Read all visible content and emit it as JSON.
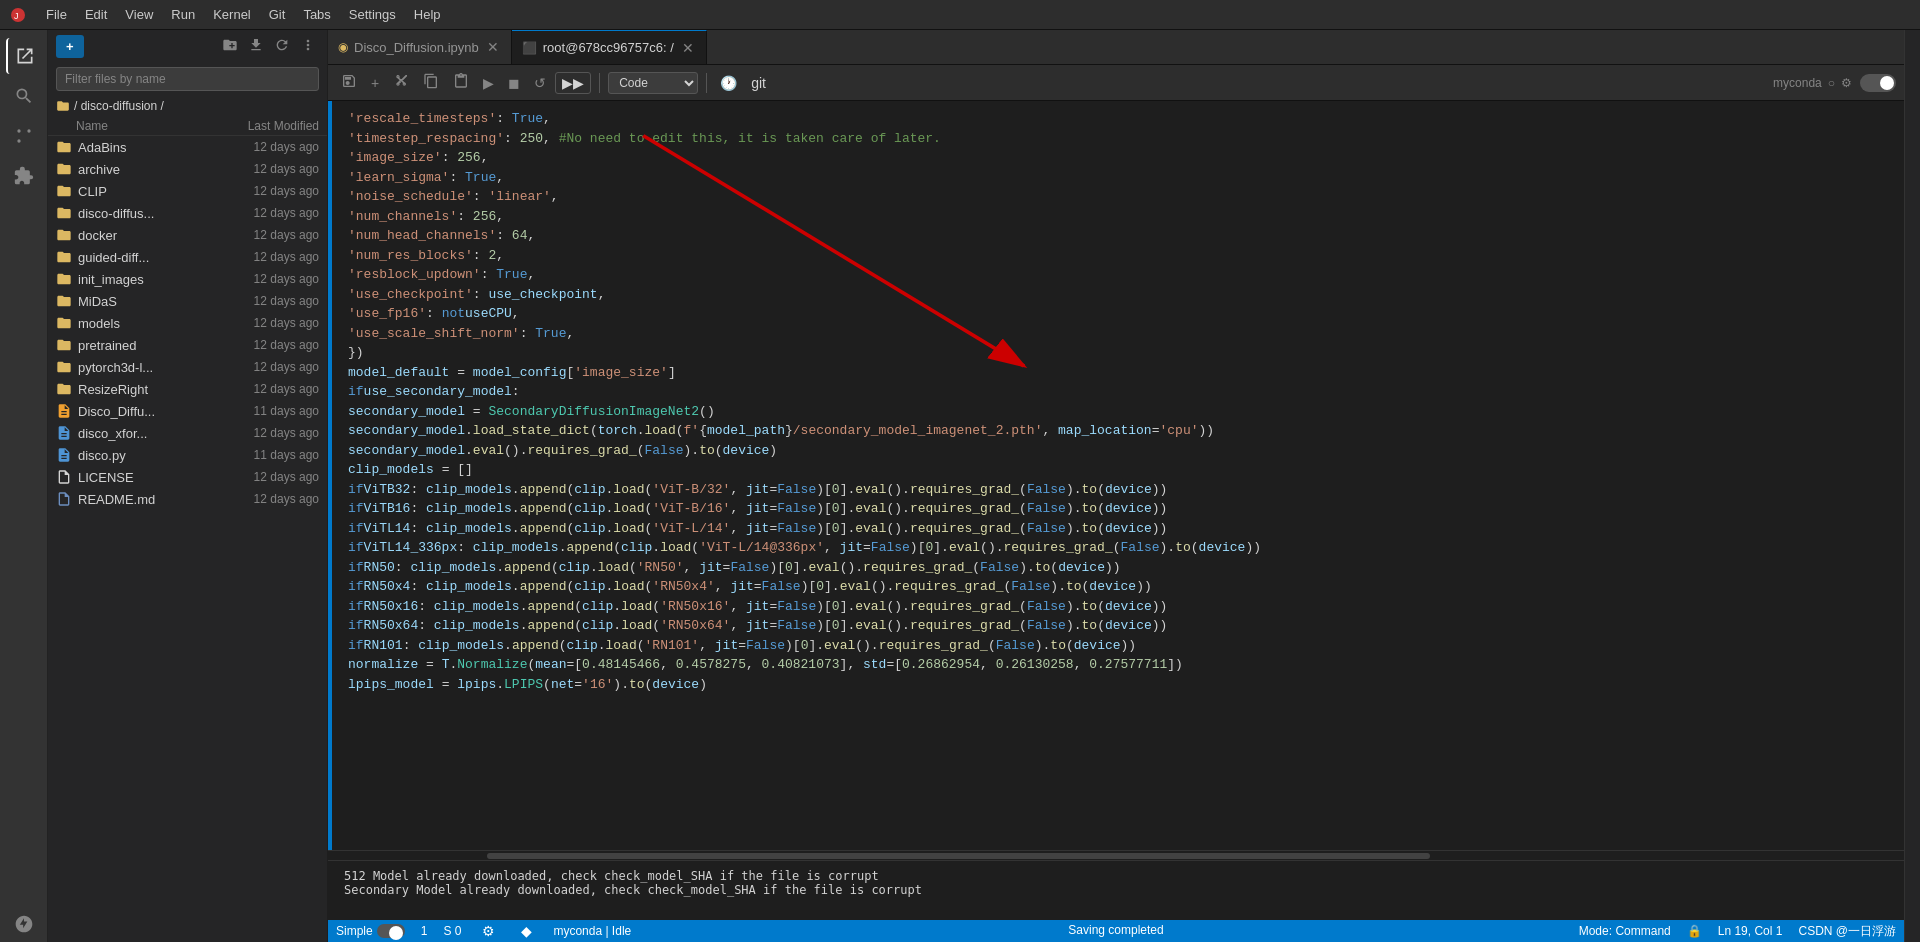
{
  "menubar": {
    "items": [
      "File",
      "Edit",
      "View",
      "Run",
      "Kernel",
      "Git",
      "Tabs",
      "Settings",
      "Help"
    ]
  },
  "tabs": [
    {
      "label": "Disco_Diffusion.ipynb",
      "active": false,
      "icon": "notebook"
    },
    {
      "label": "root@678cc96757c6: /",
      "active": true,
      "icon": "terminal"
    }
  ],
  "toolbar": {
    "buttons": [
      "save",
      "add-cell",
      "cut",
      "copy",
      "paste",
      "run",
      "stop",
      "restart",
      "run-next"
    ],
    "run_next_label": "▶▶",
    "cell_type": "Code",
    "time_icon": "🕐",
    "git_label": "git",
    "conda_label": "myconda",
    "settings_icon": "⚙"
  },
  "sidebar": {
    "new_button": "+",
    "breadcrumb": "/ disco-diffusion /",
    "search_placeholder": "Filter files by name",
    "headers": {
      "name": "Name",
      "modified": "Last Modified"
    },
    "files": [
      {
        "name": "AdaBins",
        "type": "folder",
        "modified": "12 days ago"
      },
      {
        "name": "archive",
        "type": "folder",
        "modified": "12 days ago"
      },
      {
        "name": "CLIP",
        "type": "folder",
        "modified": "12 days ago"
      },
      {
        "name": "disco-diffus...",
        "type": "folder",
        "modified": "12 days ago"
      },
      {
        "name": "docker",
        "type": "folder",
        "modified": "12 days ago"
      },
      {
        "name": "guided-diff...",
        "type": "folder",
        "modified": "12 days ago"
      },
      {
        "name": "init_images",
        "type": "folder",
        "modified": "12 days ago"
      },
      {
        "name": "MiDaS",
        "type": "folder",
        "modified": "12 days ago"
      },
      {
        "name": "models",
        "type": "folder",
        "modified": "12 days ago"
      },
      {
        "name": "pretrained",
        "type": "folder",
        "modified": "12 days ago"
      },
      {
        "name": "pytorch3d-l...",
        "type": "folder",
        "modified": "12 days ago"
      },
      {
        "name": "ResizeRight",
        "type": "folder",
        "modified": "12 days ago"
      },
      {
        "name": "Disco_Diffu...",
        "type": "file-notebook",
        "modified": "11 days ago"
      },
      {
        "name": "disco_xfor...",
        "type": "file-python",
        "modified": "12 days ago"
      },
      {
        "name": "disco.py",
        "type": "file-python",
        "modified": "11 days ago"
      },
      {
        "name": "LICENSE",
        "type": "file",
        "modified": "12 days ago"
      },
      {
        "name": "README.md",
        "type": "file-md",
        "modified": "12 days ago"
      }
    ]
  },
  "code": {
    "lines": [
      {
        "num": "",
        "text": "'rescale_timesteps': True,"
      },
      {
        "num": "",
        "text": "'timestep_respacing': 250, #No need to edit this, it is taken care of later."
      },
      {
        "num": "",
        "text": "'image_size': 256,"
      },
      {
        "num": "",
        "text": "'learn_sigma': True,"
      },
      {
        "num": "",
        "text": "'noise_schedule': 'linear',"
      },
      {
        "num": "",
        "text": "'num_channels': 256,"
      },
      {
        "num": "",
        "text": "'num_head_channels': 64,"
      },
      {
        "num": "",
        "text": "'num_res_blocks': 2,"
      },
      {
        "num": "",
        "text": "'resblock_updown': True,"
      },
      {
        "num": "",
        "text": "'use_checkpoint': use_checkpoint,"
      },
      {
        "num": "",
        "text": "'use_fp16': not useCPU,"
      },
      {
        "num": "",
        "text": "'use_scale_shift_norm': True,"
      },
      {
        "num": "",
        "text": "})"
      },
      {
        "num": "",
        "text": ""
      },
      {
        "num": "",
        "text": "model_default = model_config['image_size']"
      },
      {
        "num": "",
        "text": ""
      },
      {
        "num": "",
        "text": "if use_secondary_model:"
      },
      {
        "num": "",
        "text": "    secondary_model = SecondaryDiffusionImageNet2()"
      },
      {
        "num": "",
        "text": "    secondary_model.load_state_dict(torch.load(f'{model_path}/secondary_model_imagenet_2.pth', map_location='cpu'))"
      },
      {
        "num": "",
        "text": "    secondary_model.eval().requires_grad_(False).to(device)"
      },
      {
        "num": "",
        "text": ""
      },
      {
        "num": "",
        "text": "clip_models = []"
      },
      {
        "num": "",
        "text": "if ViTB32: clip_models.append(clip.load('ViT-B/32', jit=False)[0].eval().requires_grad_(False).to(device))"
      },
      {
        "num": "",
        "text": "if ViTB16: clip_models.append(clip.load('ViT-B/16', jit=False)[0].eval().requires_grad_(False).to(device))"
      },
      {
        "num": "",
        "text": "if ViTL14: clip_models.append(clip.load('ViT-L/14', jit=False)[0].eval().requires_grad_(False).to(device))"
      },
      {
        "num": "",
        "text": "if ViTL14_336px: clip_models.append(clip.load('ViT-L/14@336px', jit=False)[0].eval().requires_grad_(False).to(device))"
      },
      {
        "num": "",
        "text": "if RN50: clip_models.append(clip.load('RN50', jit=False)[0].eval().requires_grad_(False).to(device))"
      },
      {
        "num": "",
        "text": "if RN50x4: clip_models.append(clip.load('RN50x4', jit=False)[0].eval().requires_grad_(False).to(device))"
      },
      {
        "num": "",
        "text": "if RN50x16: clip_models.append(clip.load('RN50x16', jit=False)[0].eval().requires_grad_(False).to(device))"
      },
      {
        "num": "",
        "text": "if RN50x64: clip_models.append(clip.load('RN50x64', jit=False)[0].eval().requires_grad_(False).to(device))"
      },
      {
        "num": "",
        "text": "if RN101: clip_models.append(clip.load('RN101', jit=False)[0].eval().requires_grad_(False).to(device))"
      },
      {
        "num": "",
        "text": ""
      },
      {
        "num": "",
        "text": "normalize = T.Normalize(mean=[0.48145466, 0.4578275, 0.40821073], std=[0.26862954, 0.26130258, 0.27577711])"
      },
      {
        "num": "",
        "text": "lpips_model = lpips.LPIPS(net='16').to(device)"
      }
    ]
  },
  "statusbar": {
    "left": [
      {
        "label": "Simple"
      },
      {
        "label": "1"
      },
      {
        "label": "S 0"
      },
      {
        "label": "⚙"
      },
      {
        "label": "◆"
      },
      {
        "label": "myconda | Idle"
      }
    ],
    "center": "Saving completed",
    "right": [
      {
        "label": "Mode: Command"
      },
      {
        "label": "🔒"
      },
      {
        "label": "Ln 19, Col 1"
      },
      {
        "label": "CSDN @一日浮游"
      }
    ]
  },
  "output": {
    "lines": [
      "512 Model already downloaded, check check_model_SHA if the file is corrupt",
      "Secondary Model already downloaded, check check_model_SHA if the file is corrupt"
    ]
  }
}
